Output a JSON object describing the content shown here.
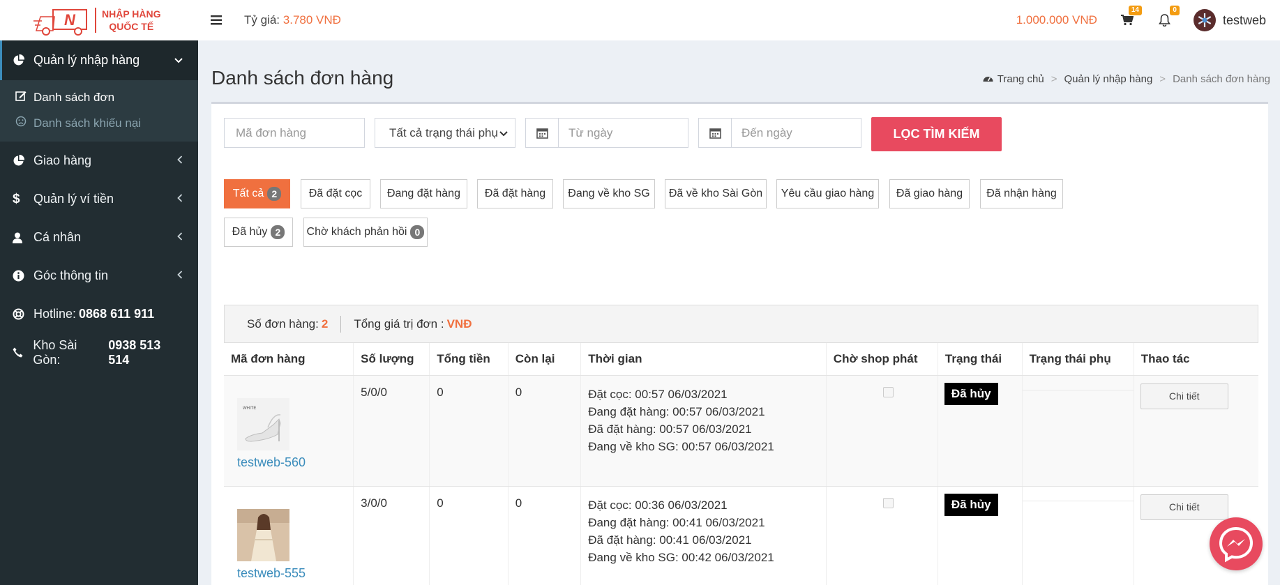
{
  "header": {
    "logo_line1": "NHẬP HÀNG",
    "logo_line2": "QUỐC TẾ",
    "rate_label": "Tỷ giá:",
    "rate_value": "3.780 VNĐ",
    "balance": "1.000.000 VNĐ",
    "cart_count": "14",
    "notif_count": "0",
    "username": "testweb"
  },
  "sidebar": {
    "items": [
      {
        "label": "Quản lý nhập hàng",
        "icon": "pie-chart-icon"
      },
      {
        "label": "Giao hàng",
        "icon": "pie-chart-icon"
      },
      {
        "label": "Quản lý ví tiền",
        "icon": "dollar-icon"
      },
      {
        "label": "Cá nhân",
        "icon": "user-icon"
      },
      {
        "label": "Góc thông tin",
        "icon": "info-icon"
      }
    ],
    "submenu": [
      {
        "label": "Danh sách đơn",
        "icon": "edit-icon"
      },
      {
        "label": "Danh sách khiếu nại",
        "icon": "frown-icon"
      }
    ],
    "hotline_label": "Hotline:",
    "hotline_value": "0868 611 911",
    "warehouse_label": "Kho Sài Gòn:",
    "warehouse_value": "0938 513 514"
  },
  "page": {
    "title": "Danh sách đơn hàng",
    "breadcrumb": [
      "Trang chủ",
      "Quản lý nhập hàng",
      "Danh sách đơn hàng"
    ]
  },
  "filters": {
    "code_placeholder": "Mã đơn hàng",
    "status_selected": "Tất cả trạng thái phụ",
    "from_placeholder": "Từ ngày",
    "to_placeholder": "Đến ngày",
    "search_button": "LỌC TÌM KIẾM"
  },
  "tabs": [
    {
      "label": "Tất cả",
      "count": "2"
    },
    {
      "label": "Đã đặt cọc"
    },
    {
      "label": "Đang đặt hàng"
    },
    {
      "label": "Đã đặt hàng"
    },
    {
      "label": "Đang về kho SG"
    },
    {
      "label": "Đã về kho Sài Gòn"
    },
    {
      "label": "Yêu cầu giao hàng"
    },
    {
      "label": "Đã giao hàng"
    },
    {
      "label": "Đã nhận hàng"
    },
    {
      "label": "Đã hủy",
      "count": "2"
    },
    {
      "label": "Chờ khách phản hồi",
      "count": "0"
    }
  ],
  "summary": {
    "count_label": "Số đơn hàng:",
    "count_value": "2",
    "total_label": "Tổng giá trị đơn :",
    "total_value": "VNĐ"
  },
  "table": {
    "headers": [
      "Mã đơn hàng",
      "Số lượng",
      "Tổng tiền",
      "Còn lại",
      "Thời gian",
      "Chờ shop phát",
      "Trạng thái",
      "Trạng thái phụ",
      "Thao tác"
    ],
    "rows": [
      {
        "code": "testweb-560",
        "qty": "5/0/0",
        "total": "0",
        "remaining": "0",
        "times": [
          "Đặt cọc: 00:57 06/03/2021",
          "Đang đặt hàng: 00:57 06/03/2021",
          "Đã đặt hàng: 00:57 06/03/2021",
          "Đang về kho SG: 00:57 06/03/2021"
        ],
        "status": "Đã hủy",
        "action": "Chi tiết"
      },
      {
        "code": "testweb-555",
        "qty": "3/0/0",
        "total": "0",
        "remaining": "0",
        "times": [
          "Đặt cọc: 00:36 06/03/2021",
          "Đang đặt hàng: 00:41 06/03/2021",
          "Đã đặt hàng: 00:41 06/03/2021",
          "Đang về kho SG: 00:42 06/03/2021"
        ],
        "status": "Đã hủy",
        "action": "Chi tiết"
      }
    ]
  },
  "colors": {
    "accent": "#f0703f",
    "primary_button": "#e84a5f",
    "sidebar_bg": "#222d32",
    "link": "#3c8dbc"
  }
}
